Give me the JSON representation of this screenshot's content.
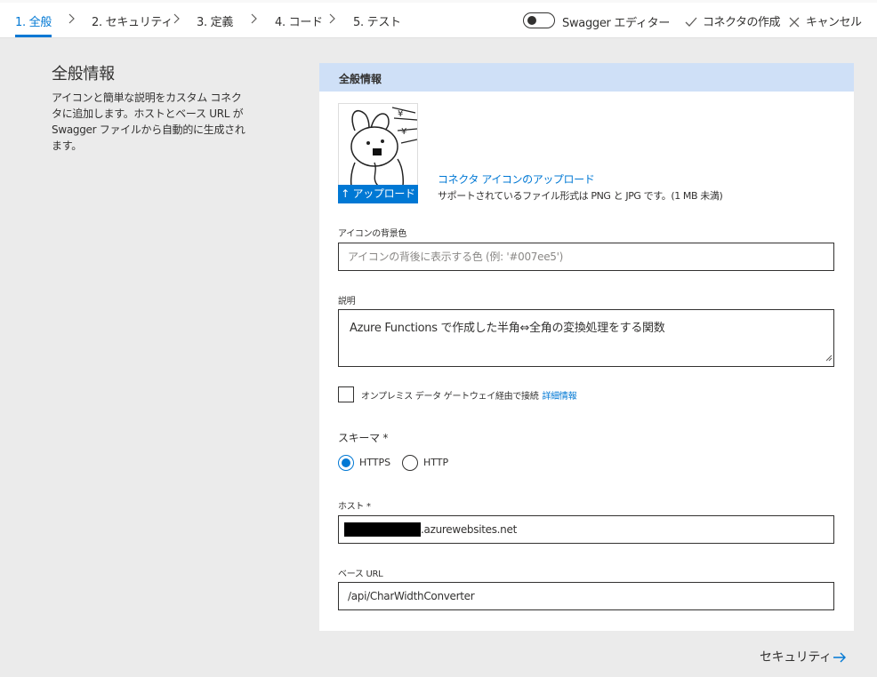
{
  "wizard": {
    "steps": [
      {
        "label": "1. 全般"
      },
      {
        "label": "2. セキュリティ"
      },
      {
        "label": "3. 定義"
      },
      {
        "label": "4. コード"
      },
      {
        "label": "5. テスト"
      }
    ],
    "swagger_toggle_label": "Swagger エディター",
    "create_label": "コネクタの作成",
    "cancel_label": "キャンセル"
  },
  "intro": {
    "title": "全般情報",
    "description": "アイコンと簡単な説明をカスタム コネクタに追加します。ホストとベース URL が Swagger ファイルから自動的に生成されます。"
  },
  "card": {
    "header": "全般情報",
    "upload_button": "↑ アップロード",
    "upload_link": "コネクタ アイコンのアップロード",
    "upload_note": "サポートされているファイル形式は PNG と JPG です。(1 MB 未満)",
    "icon_bg_label": "アイコンの背景色",
    "icon_bg_placeholder": "アイコンの背後に表示する色 (例: '#007ee5')",
    "description_label": "説明",
    "description_value": "Azure Functions で作成した半角⇔全角の変換処理をする関数",
    "gateway_label": "オンプレミス データ ゲートウェイ経由で接続",
    "gateway_link": "詳細情報",
    "schema_label": "スキーマ *",
    "schema_https": "HTTPS",
    "schema_http": "HTTP",
    "host_label": "ホスト *",
    "host_value": ".azurewebsites.net",
    "base_url_label": "ベース URL",
    "base_url_value": "/api/CharWidthConverter"
  },
  "footer": {
    "next_label": "セキュリティ"
  },
  "colors": {
    "accent": "#0078d4",
    "header_bg": "#cfe0f7",
    "page_bg": "#ebebeb"
  }
}
